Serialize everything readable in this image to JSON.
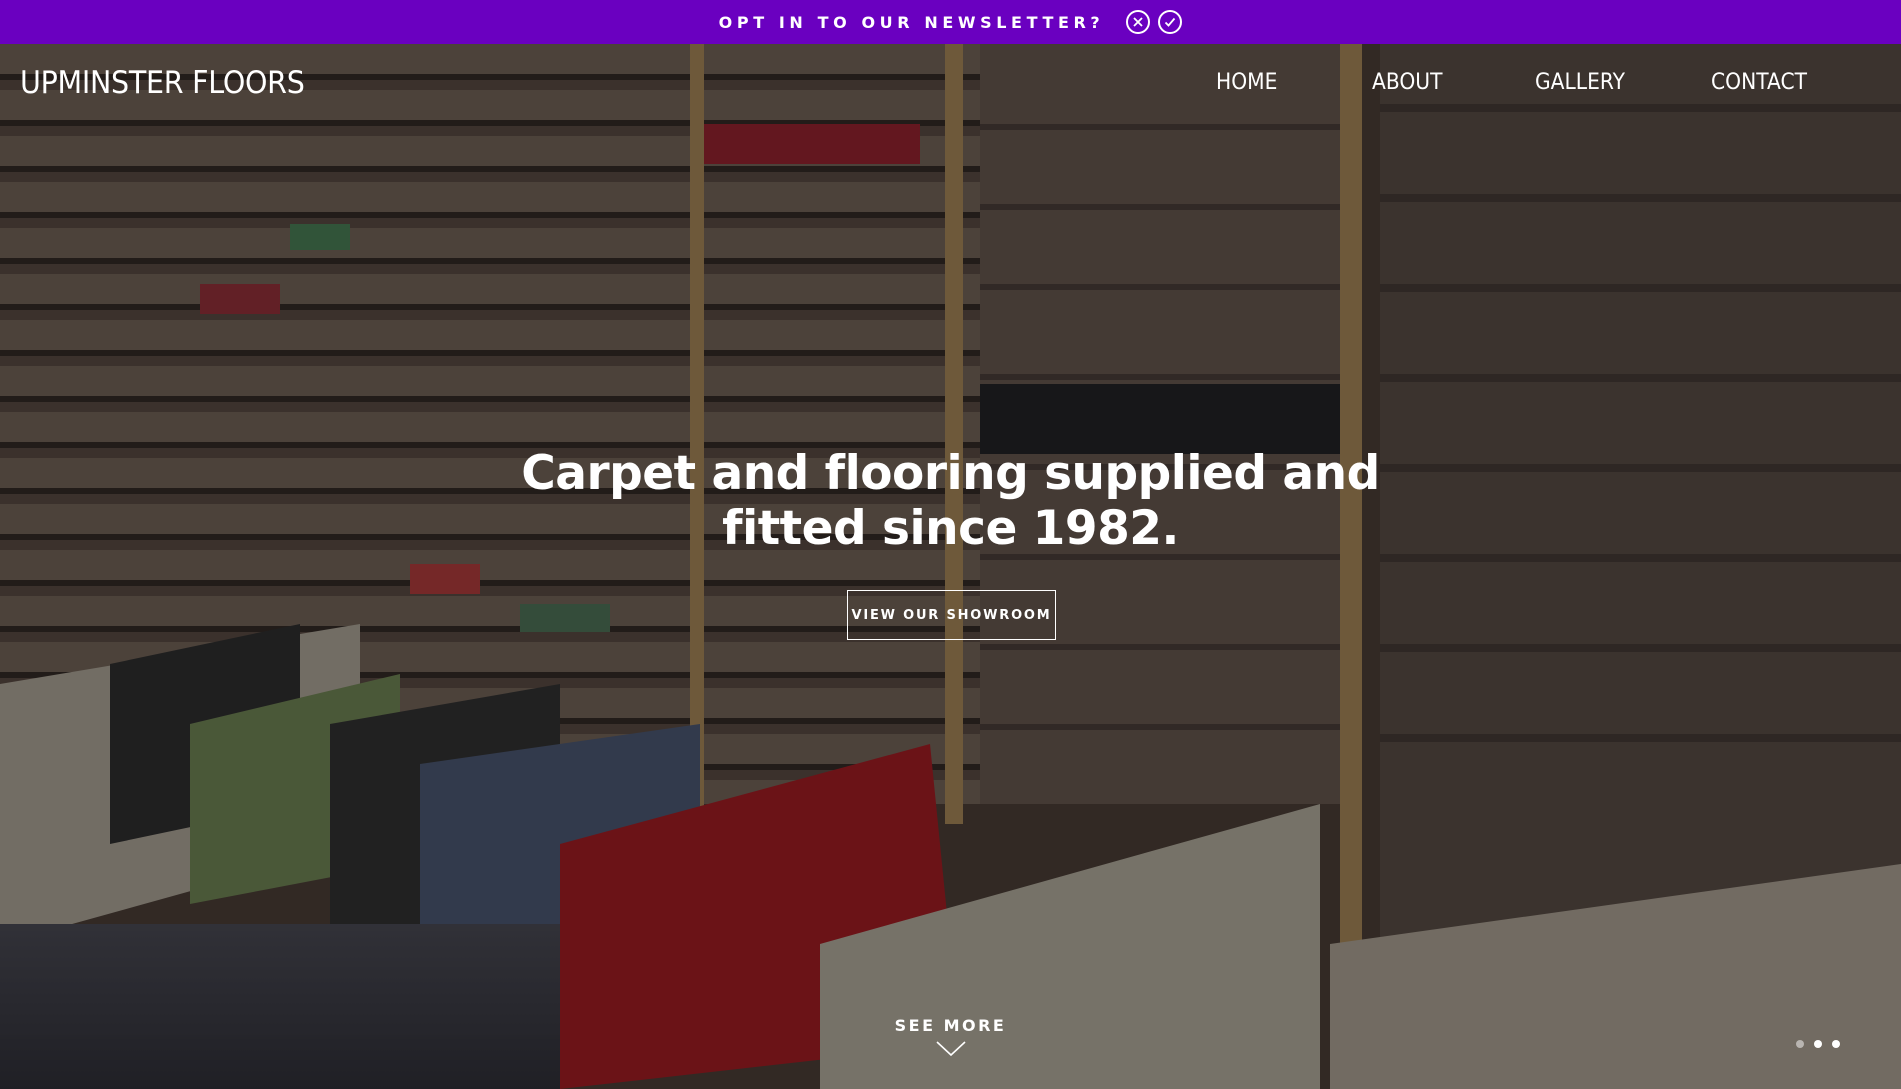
{
  "newsletter": {
    "text": "OPT IN TO OUR NEWSLETTER?",
    "dismiss_icon": "close-circle-icon",
    "accept_icon": "check-circle-icon",
    "bar_color": "#6a00c0"
  },
  "header": {
    "logo": "UPMINSTER FLOORS",
    "nav": [
      "HOME",
      "ABOUT",
      "GALLERY",
      "CONTACT"
    ]
  },
  "hero": {
    "headline_line1": "Carpet and flooring supplied and",
    "headline_line2": "fitted since 1982.",
    "cta": "VIEW OUR SHOWROOM",
    "see_more": "SEE MORE",
    "see_more_icon": "chevron-down-icon",
    "slides": {
      "count": 3,
      "active_index": 1
    }
  }
}
